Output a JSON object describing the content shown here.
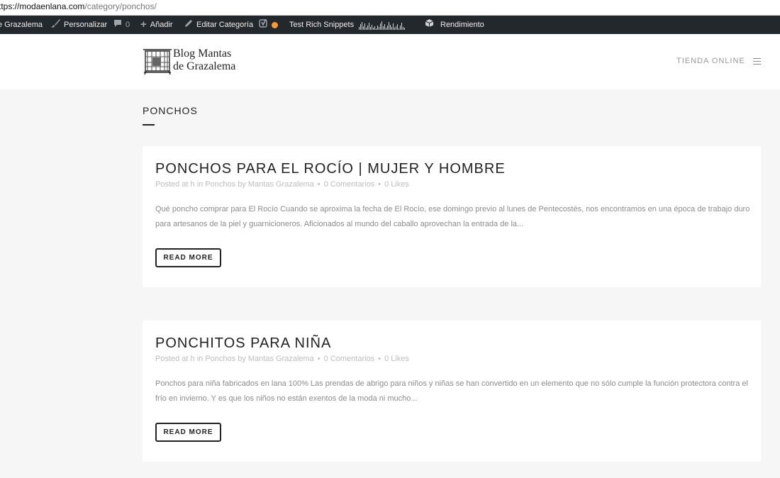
{
  "browser": {
    "url_host": "ttps://modaenlana.com",
    "url_path": "/category/ponchos/"
  },
  "admin_bar": {
    "site_name": "e Grazalema",
    "customize": "Personalizar",
    "comments_count": "0",
    "add_new": "Añadir",
    "edit_category": "Editar Categoría",
    "rich_snippets": "Test Rich Snippets",
    "performance": "Rendimiento"
  },
  "header": {
    "logo_line1": "Blog Mantas",
    "logo_line2": "de Grazalema",
    "nav_tienda": "TIENDA ONLINE"
  },
  "category": {
    "title": "PONCHOS"
  },
  "posts": [
    {
      "title": "PONCHOS PARA EL ROCÍO | MUJER Y HOMBRE",
      "meta_posted": "Posted at h in Ponchos by Mantas Grazalema",
      "meta_comments": "0 Comentarios",
      "meta_likes": "0 Likes",
      "excerpt": "Qué poncho comprar para El Rocío Cuando se aproxima la fecha de El Rocío, ese domingo previo al lunes de Pentecostés, nos encontramos en una época de trabajo duro para artesanos de la piel y guarnicioneros. Aficionados al mundo del caballo aprovechan la entrada de la...",
      "button": "READ MORE"
    },
    {
      "title": "PONCHITOS PARA NIÑA",
      "meta_posted": "Posted at h in Ponchos by Mantas Grazalema",
      "meta_comments": "0 Comentarios",
      "meta_likes": "0 Likes",
      "excerpt": "Ponchos para niña fabricados en lana 100% Las prendas de abrigo para niños y niñas se han convertido en un elemento que no sólo cumple la función protectora contra el frío en invierno. Y es que los niños no están exentos de la moda ni mucho...",
      "button": "READ MORE"
    }
  ],
  "colors": {
    "admin_bar": "#23282d",
    "page_bg": "#f6f6f6",
    "card_bg": "#ffffff",
    "meta_text": "#bdbdbd",
    "excerpt_text": "#8c8c8c",
    "yoast_dot": "#f79a34"
  }
}
